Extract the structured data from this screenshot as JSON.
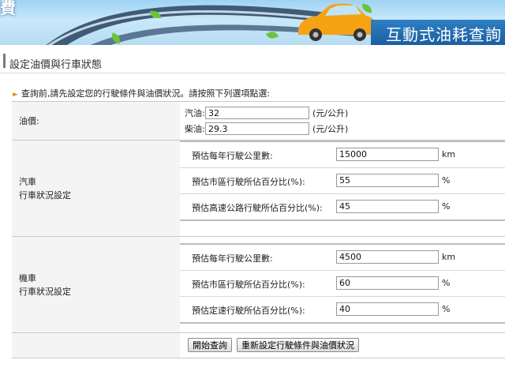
{
  "banner": {
    "logo_fragment": "費",
    "title": "互動式油耗查詢"
  },
  "section": {
    "title": "設定油價與行車狀態",
    "hint": "查詢前,請先設定您的行駛條件與油價狀況。請按照下列選項點選:"
  },
  "fuel_price": {
    "label": "油價:",
    "gasoline_label": "汽油:",
    "gasoline_value": "32",
    "diesel_label": "柴油:",
    "diesel_value": "29.3",
    "unit": "(元/公升)"
  },
  "car": {
    "label_line1": "汽車",
    "label_line2": "行車狀況設定",
    "rows": [
      {
        "question": "預估每年行駛公里數:",
        "value": "15000",
        "unit": "km"
      },
      {
        "question": "預估市區行駛所佔百分比(%):",
        "value": "55",
        "unit": "%"
      },
      {
        "question": "預估高速公路行駛所佔百分比(%):",
        "value": "45",
        "unit": "%"
      }
    ]
  },
  "motorcycle": {
    "label_line1": "機車",
    "label_line2": "行車狀況設定",
    "rows": [
      {
        "question": "預估每年行駛公里數:",
        "value": "4500",
        "unit": "km"
      },
      {
        "question": "預估市區行駛所佔百分比(%):",
        "value": "60",
        "unit": "%"
      },
      {
        "question": "預估定速行駛所佔百分比(%):",
        "value": "40",
        "unit": "%"
      }
    ]
  },
  "actions": {
    "start_label": "開始查詢",
    "reset_label": "重新設定行駛條件與油價狀況"
  },
  "colors": {
    "banner_blue": "#1b5ea0",
    "label_bg": "#f4f4f4",
    "hint_arrow": "#e08a00"
  }
}
